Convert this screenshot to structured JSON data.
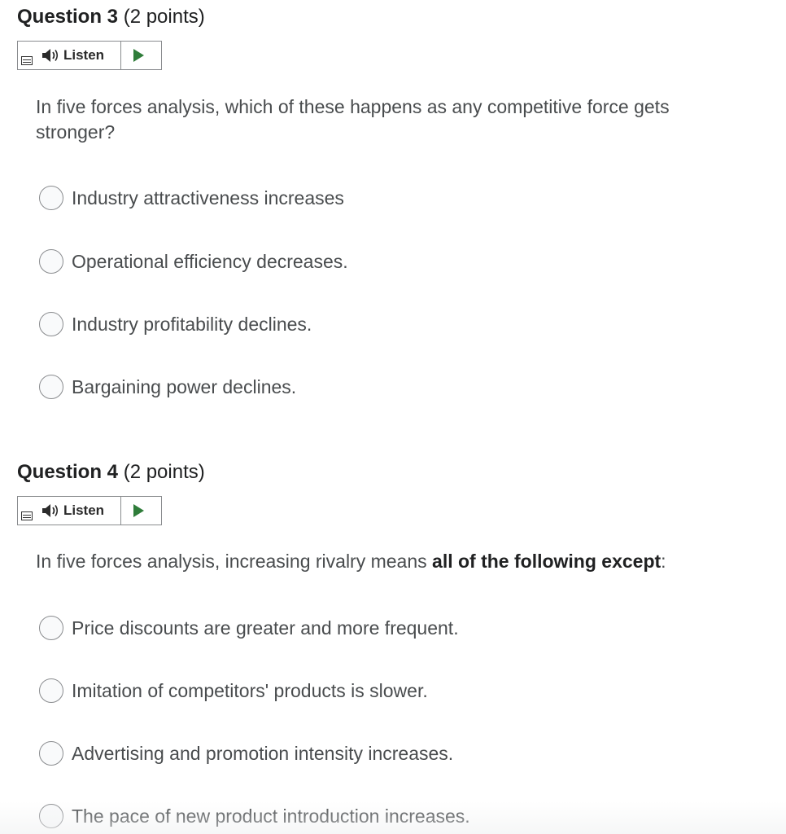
{
  "questions": [
    {
      "label": "Question 3",
      "points": "(2 points)",
      "listen": {
        "label": "Listen",
        "menu_icon": "menu-icon",
        "speaker_icon": "speaker-icon",
        "play_icon": "play-icon"
      },
      "text_plain": "In five forces analysis, which of these happens as any competitive force gets stronger?",
      "options": [
        "Industry attractiveness increases",
        "Operational efficiency decreases.",
        "Industry profitability declines.",
        "Bargaining power declines."
      ]
    },
    {
      "label": "Question 4",
      "points": "(2 points)",
      "listen": {
        "label": "Listen",
        "menu_icon": "menu-icon",
        "speaker_icon": "speaker-icon",
        "play_icon": "play-icon"
      },
      "text_prefix": "In five forces analysis, increasing rivalry means ",
      "text_bold": "all of the following except",
      "text_suffix": ":",
      "options": [
        "Price discounts are greater and more frequent.",
        "Imitation of competitors' products is slower.",
        "Advertising and promotion intensity increases.",
        "The pace of new product introduction increases."
      ]
    }
  ],
  "colors": {
    "play_icon": "#2f7d3a",
    "border": "#8a8c8f",
    "text": "#494c4e",
    "title": "#202122"
  }
}
